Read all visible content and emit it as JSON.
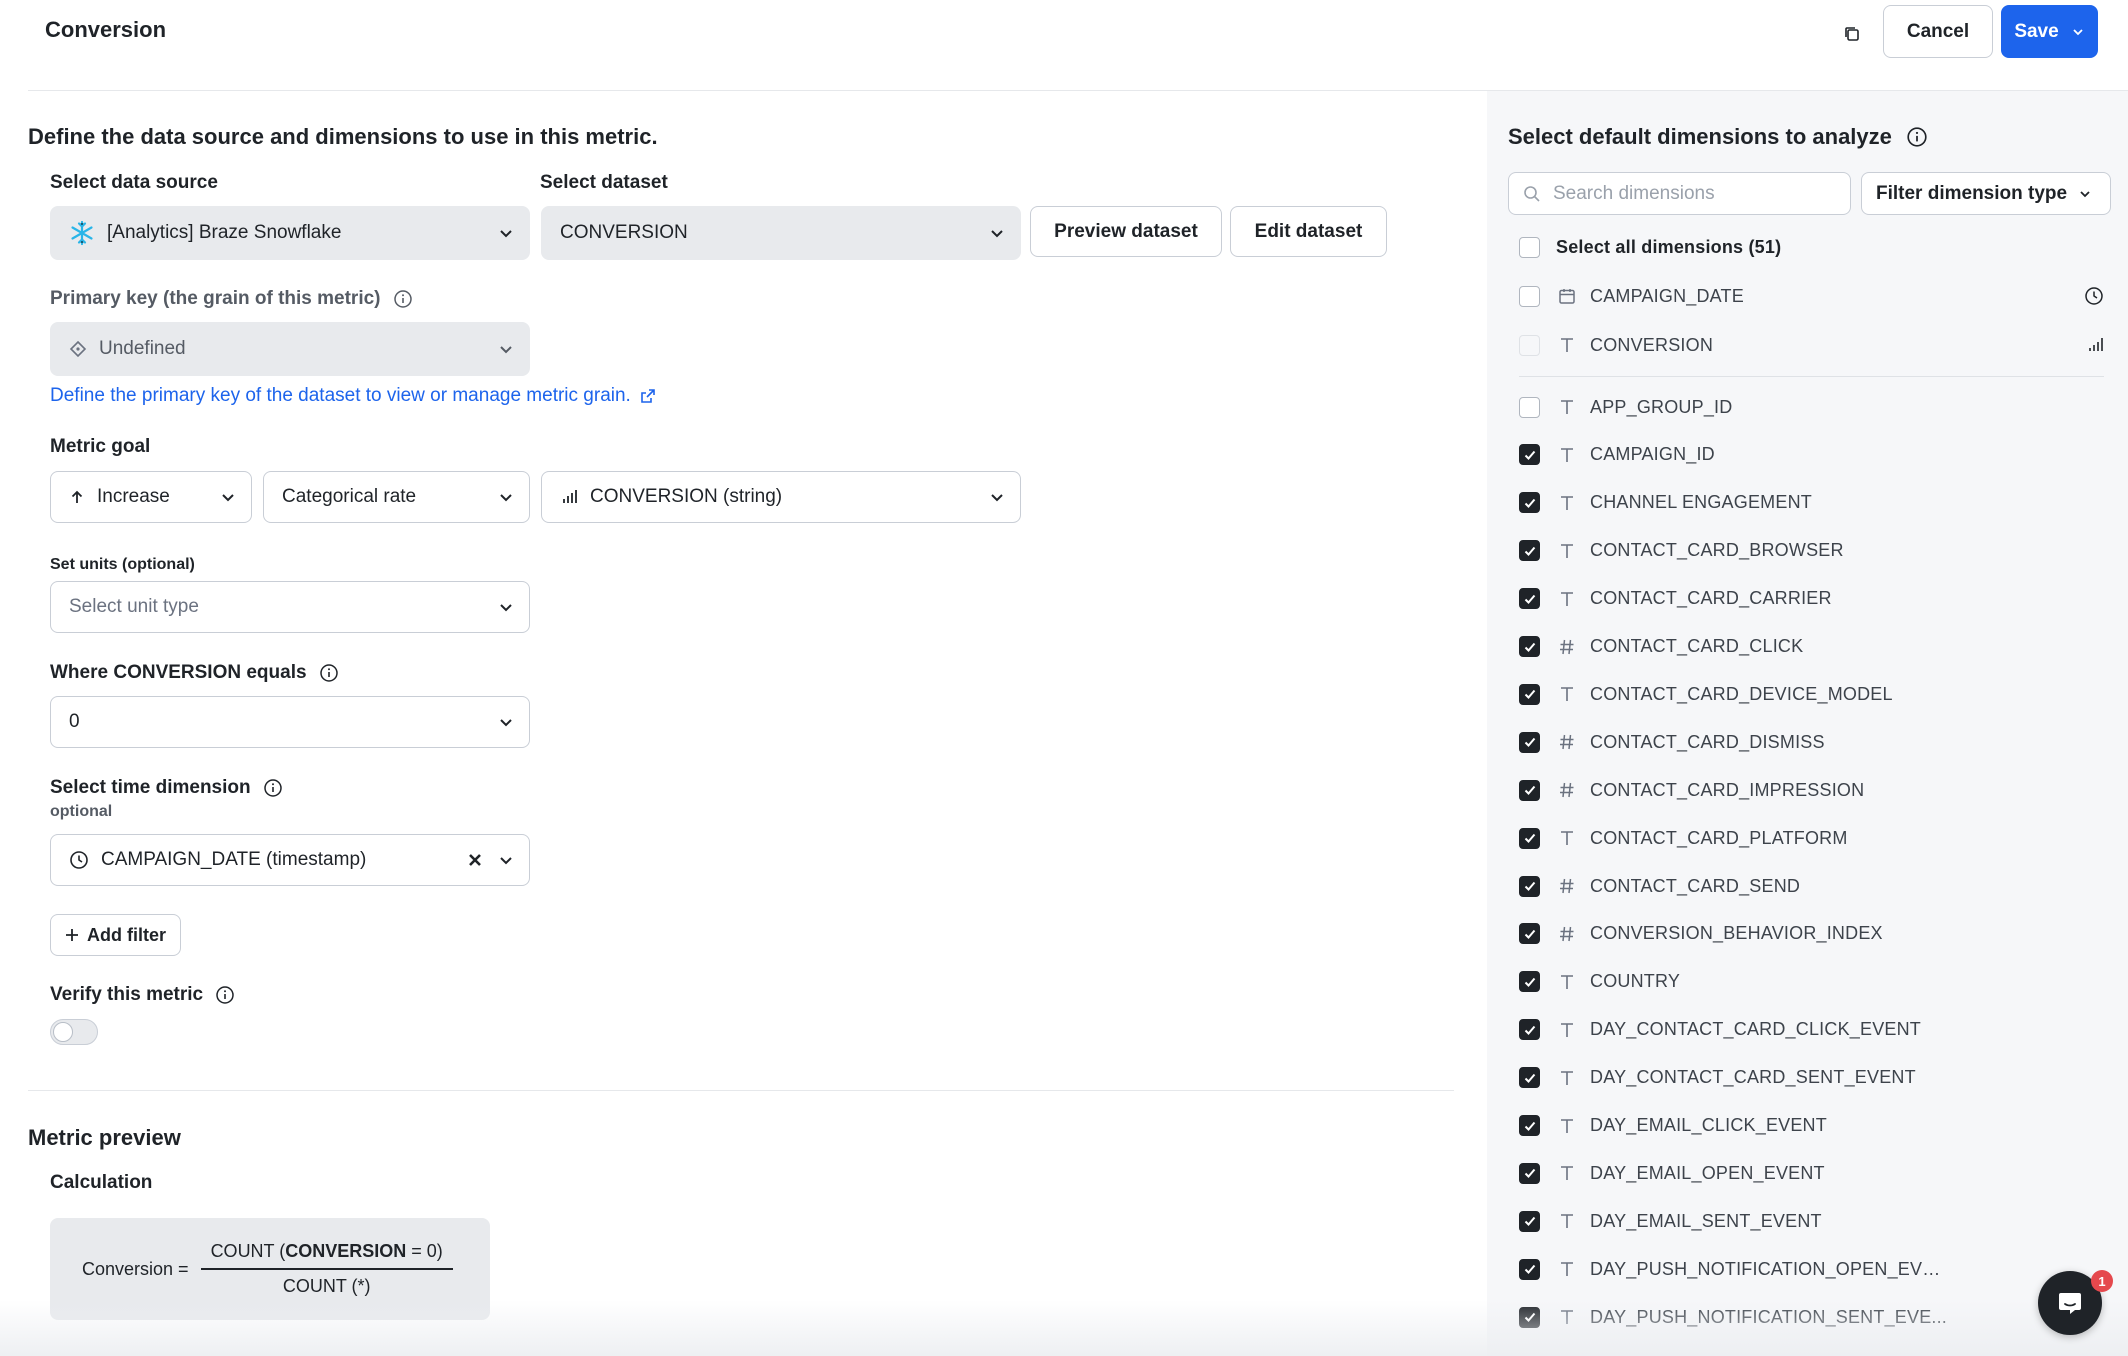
{
  "header": {
    "title": "Conversion",
    "cancel_label": "Cancel",
    "save_label": "Save"
  },
  "left": {
    "intro": "Define the data source and dimensions to use in this metric.",
    "data_source": {
      "label": "Select data source",
      "value": "[Analytics] Braze Snowflake"
    },
    "dataset": {
      "label": "Select dataset",
      "value": "CONVERSION"
    },
    "preview_dataset_label": "Preview dataset",
    "edit_dataset_label": "Edit dataset",
    "primary_key": {
      "label": "Primary key (the grain of this metric)",
      "value": "Undefined",
      "link": "Define the primary key of the dataset to view or manage metric grain."
    },
    "metric_goal": {
      "label": "Metric goal",
      "direction": "Increase",
      "type": "Categorical rate",
      "column": "CONVERSION (string)"
    },
    "units": {
      "label": "Set units (optional)",
      "placeholder": "Select unit type"
    },
    "where": {
      "label": "Where CONVERSION equals",
      "value": "0"
    },
    "time_dimension": {
      "label": "Select time dimension",
      "sublabel": "optional",
      "value": "CAMPAIGN_DATE (timestamp)"
    },
    "add_filter_label": "Add filter",
    "verify": {
      "label": "Verify this metric",
      "enabled": false
    },
    "preview": {
      "title": "Metric preview",
      "calc_label": "Calculation",
      "lhs": "Conversion =",
      "num_prefix": "COUNT (",
      "num_bold": "CONVERSION",
      "num_suffix": " = 0)",
      "den": "COUNT (*)"
    }
  },
  "right": {
    "title": "Select default dimensions to analyze",
    "search_placeholder": "Search dimensions",
    "filter_type_label": "Filter dimension type",
    "select_all_label": "Select all dimensions (51)",
    "pinned": [
      {
        "name": "CAMPAIGN_DATE",
        "type": "calendar",
        "checked": false,
        "trail": "clock"
      },
      {
        "name": "CONVERSION",
        "type": "text",
        "checked": false,
        "trail": "chart"
      }
    ],
    "dimensions": [
      {
        "name": "APP_GROUP_ID",
        "type": "text",
        "checked": false
      },
      {
        "name": "CAMPAIGN_ID",
        "type": "text",
        "checked": true
      },
      {
        "name": "CHANNEL ENGAGEMENT",
        "type": "text",
        "checked": true
      },
      {
        "name": "CONTACT_CARD_BROWSER",
        "type": "text",
        "checked": true
      },
      {
        "name": "CONTACT_CARD_CARRIER",
        "type": "text",
        "checked": true
      },
      {
        "name": "CONTACT_CARD_CLICK",
        "type": "number",
        "checked": true
      },
      {
        "name": "CONTACT_CARD_DEVICE_MODEL",
        "type": "text",
        "checked": true
      },
      {
        "name": "CONTACT_CARD_DISMISS",
        "type": "number",
        "checked": true
      },
      {
        "name": "CONTACT_CARD_IMPRESSION",
        "type": "number",
        "checked": true
      },
      {
        "name": "CONTACT_CARD_PLATFORM",
        "type": "text",
        "checked": true
      },
      {
        "name": "CONTACT_CARD_SEND",
        "type": "number",
        "checked": true
      },
      {
        "name": "CONVERSION_BEHAVIOR_INDEX",
        "type": "number",
        "checked": true
      },
      {
        "name": "COUNTRY",
        "type": "text",
        "checked": true
      },
      {
        "name": "DAY_CONTACT_CARD_CLICK_EVENT",
        "type": "text",
        "checked": true
      },
      {
        "name": "DAY_CONTACT_CARD_SENT_EVENT",
        "type": "text",
        "checked": true
      },
      {
        "name": "DAY_EMAIL_CLICK_EVENT",
        "type": "text",
        "checked": true
      },
      {
        "name": "DAY_EMAIL_OPEN_EVENT",
        "type": "text",
        "checked": true
      },
      {
        "name": "DAY_EMAIL_SENT_EVENT",
        "type": "text",
        "checked": true
      },
      {
        "name": "DAY_PUSH_NOTIFICATION_OPEN_EVE...",
        "type": "text",
        "checked": true
      },
      {
        "name": "DAY_PUSH_NOTIFICATION_SENT_EVE...",
        "type": "text",
        "checked": true
      }
    ]
  },
  "chat": {
    "badge_count": "1"
  },
  "colors": {
    "primary": "#1d64ec",
    "text": "#1f2328",
    "muted": "#6b7280",
    "panel": "#f6f7f9",
    "field": "#e8eaed",
    "badge": "#e5484d"
  }
}
